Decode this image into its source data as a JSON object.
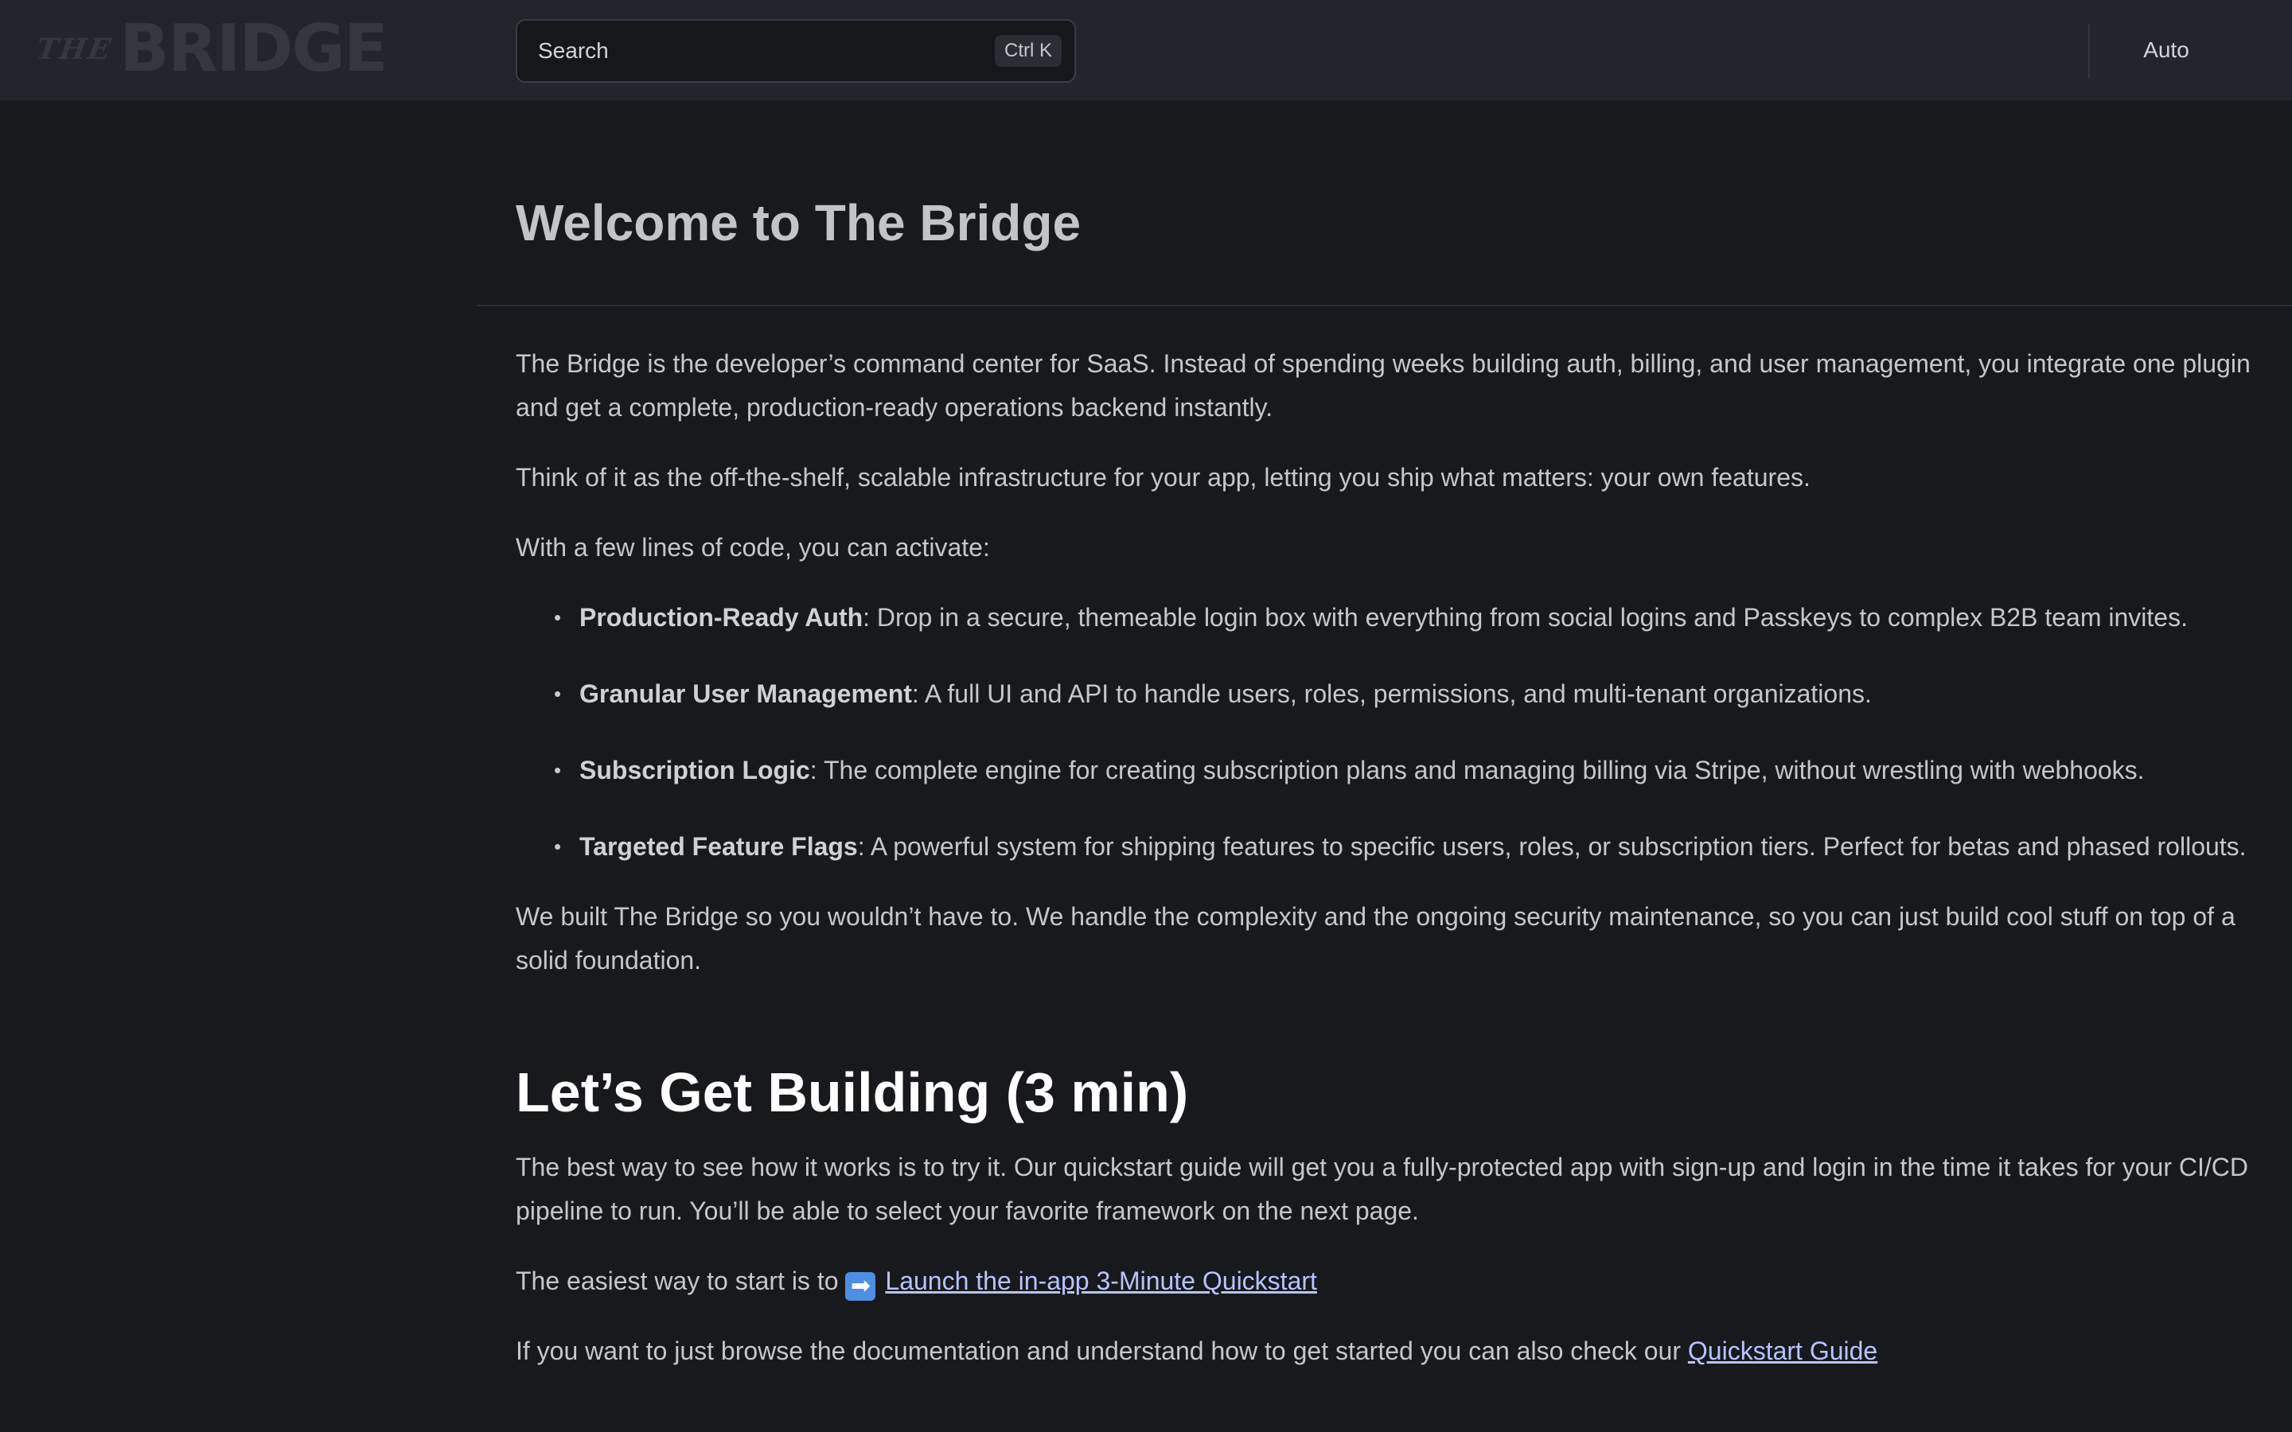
{
  "header": {
    "logo_the": "THE",
    "logo_word": "BRIDGE",
    "search_placeholder": "Search",
    "search_shortcut": "Ctrl K",
    "theme_label": "Auto"
  },
  "page": {
    "title": "Welcome to The Bridge",
    "intro_p1": "The Bridge is the developer’s command center for SaaS. Instead of spending weeks building auth, billing, and user management, you integrate one plugin and get a complete, production-ready operations backend instantly.",
    "intro_p2": "Think of it as the off-the-shelf, scalable infrastructure for your app, letting you ship what matters: your own features.",
    "intro_p3": "With a few lines of code, you can activate:",
    "features": [
      {
        "title": "Production-Ready Auth",
        "text": ": Drop in a secure, themeable login box with everything from social logins and Passkeys to complex B2B team invites."
      },
      {
        "title": "Granular User Management",
        "text": ": A full UI and API to handle users, roles, permissions, and multi-tenant organizations."
      },
      {
        "title": "Subscription Logic",
        "text": ": The complete engine for creating subscription plans and managing billing via Stripe, without wrestling with webhooks."
      },
      {
        "title": "Targeted Feature Flags",
        "text": ": A powerful system for shipping features to specific users, roles, or subscription tiers. Perfect for betas and phased rollouts."
      }
    ],
    "outro_p": "We built The Bridge so you wouldn’t have to. We handle the complexity and the ongoing security maintenance, so you can just build cool stuff on top of a solid foundation.",
    "section2_title": "Let’s Get Building (3 min)",
    "section2_p1": "The best way to see how it works is to try it. Our quickstart guide will get you a fully-protected app with sign-up and login in the time it takes for your CI/CD pipeline to run. You’ll be able to select your favorite framework on the next page.",
    "section2_p2_prefix": "The easiest way to start is to ",
    "arrow_glyph": "➡",
    "launch_link": "Launch the in-app 3-Minute Quickstart",
    "section2_p3_prefix": "If you want to just browse the documentation and understand how to get started you can also check our ",
    "quickstart_link": "Quickstart Guide"
  },
  "colors": {
    "background": "#18191d",
    "topbar": "#22252c",
    "link": "#b8c4ff",
    "arrow_badge": "#4e8fe6"
  }
}
